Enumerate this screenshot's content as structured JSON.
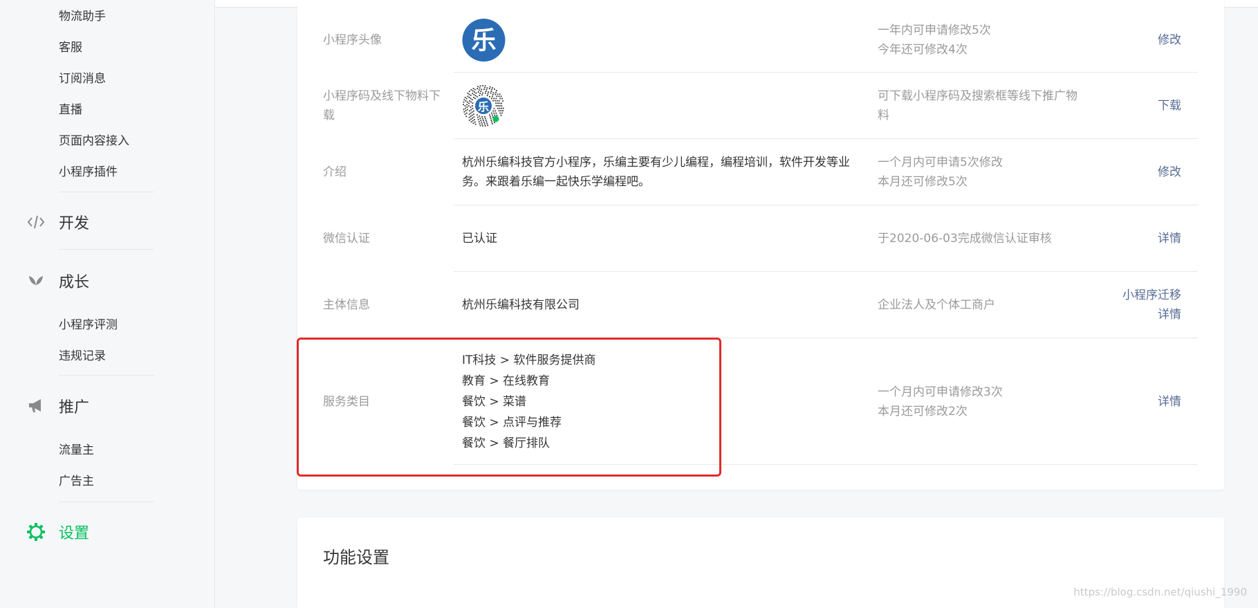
{
  "sidebar": {
    "items_top": [
      "物流助手",
      "客服",
      "订阅消息",
      "直播",
      "页面内容接入",
      "小程序插件"
    ],
    "dev": {
      "label": "开发",
      "icon": "code-icon"
    },
    "growth": {
      "label": "成长",
      "icon": "sprout-icon",
      "items": [
        "小程序评测",
        "违规记录"
      ]
    },
    "promote": {
      "label": "推广",
      "icon": "megaphone-icon",
      "items": [
        "流量主",
        "广告主"
      ]
    },
    "settings": {
      "label": "设置",
      "icon": "gear-icon",
      "active": true
    }
  },
  "info_rows": {
    "avatar": {
      "label": "小程序头像",
      "avatar_glyph": "乐",
      "desc": [
        "一年内可申请修改5次",
        "今年还可修改4次"
      ],
      "action": "修改"
    },
    "qrcode": {
      "label": "小程序码及线下物料下载",
      "qr_glyph": "乐",
      "desc": "可下载小程序码及搜索框等线下推广物料",
      "action": "下载"
    },
    "intro": {
      "label": "介绍",
      "value": "杭州乐编科技官方小程序，乐编主要有少儿编程，编程培训，软件开发等业务。来跟着乐编一起快乐学编程吧。",
      "desc": [
        "一个月内可申请5次修改",
        "本月还可修改5次"
      ],
      "action": "修改"
    },
    "wechat_auth": {
      "label": "微信认证",
      "value": "已认证",
      "desc": "于2020-06-03完成微信认证审核",
      "action": "详情"
    },
    "entity": {
      "label": "主体信息",
      "value": "杭州乐编科技有限公司",
      "desc": "企业法人及个体工商户",
      "actions": [
        "小程序迁移",
        "详情"
      ]
    },
    "service": {
      "label": "服务类目",
      "values": [
        "IT科技 > 软件服务提供商",
        "教育 > 在线教育",
        "餐饮 > 菜谱",
        "餐饮 > 点评与推荐",
        "餐饮 > 餐厅排队"
      ],
      "desc": [
        "一个月内可申请修改3次",
        "本月还可修改2次"
      ],
      "action": "详情"
    }
  },
  "function_settings": {
    "title": "功能设置"
  },
  "watermark": "https://blog.csdn.net/qiushi_1990",
  "colors": {
    "accent_green": "#07c160",
    "link_blue": "#576b95",
    "highlight_red": "#e12a2a",
    "avatar_blue": "#2b6cb5"
  }
}
